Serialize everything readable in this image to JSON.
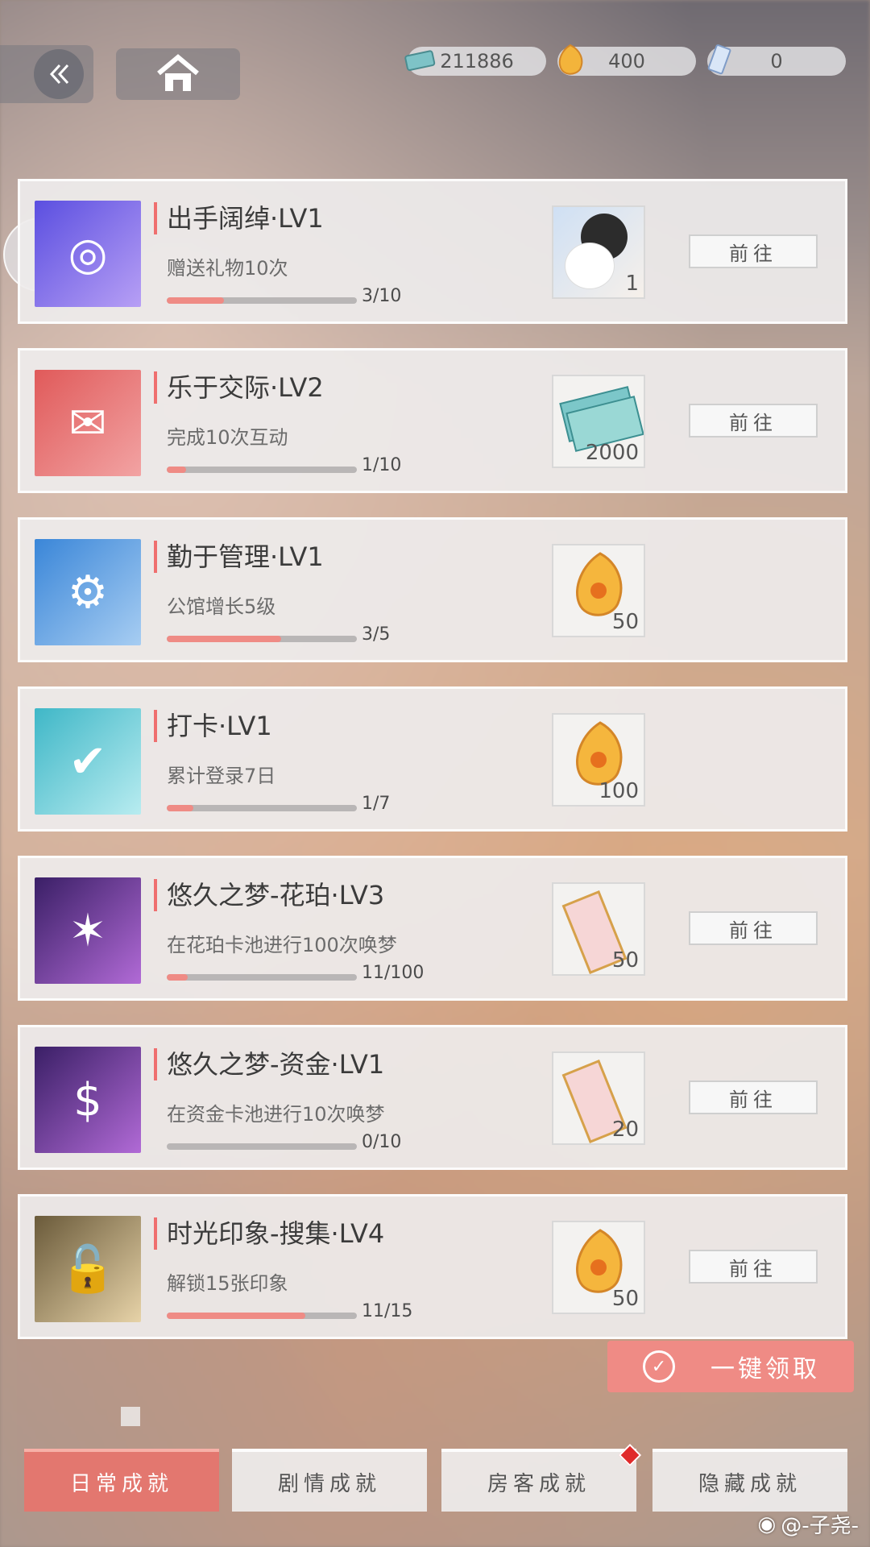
{
  "currencies": [
    {
      "icon": "cash-stack-icon",
      "value": "211886"
    },
    {
      "icon": "amber-gem-icon",
      "value": "400"
    },
    {
      "icon": "ticket-icon",
      "value": "0"
    }
  ],
  "nav": {
    "back_icon": "double-chevron-left-icon",
    "home_icon": "home-icon"
  },
  "achievements": [
    {
      "icon": "coin-gift-icon",
      "title": "出手阔绰·LV1",
      "desc": "赠送礼物10次",
      "progress": 0.3,
      "count": "3/10",
      "reward": "cat-portrait",
      "reward_qty": "1",
      "action": "前往"
    },
    {
      "icon": "chat-bubbles-icon",
      "title": "乐于交际·LV2",
      "desc": "完成10次互动",
      "progress": 0.1,
      "count": "1/10",
      "reward": "cash-stack",
      "reward_qty": "2000",
      "action": "前往"
    },
    {
      "icon": "gear-castle-icon",
      "title": "勤于管理·LV1",
      "desc": "公馆增长5级",
      "progress": 0.6,
      "count": "3/5",
      "reward": "amber-gem",
      "reward_qty": "50",
      "action": ""
    },
    {
      "icon": "calendar-check-icon",
      "title": "打卡·LV1",
      "desc": "累计登录7日",
      "progress": 0.14,
      "count": "1/7",
      "reward": "amber-gem",
      "reward_qty": "100",
      "action": ""
    },
    {
      "icon": "star-crest-icon",
      "title": "悠久之梦-花珀·LV3",
      "desc": "在花珀卡池进行100次唤梦",
      "progress": 0.11,
      "count": "11/100",
      "reward": "ticket",
      "reward_qty": "50",
      "action": "前往"
    },
    {
      "icon": "coin-crest-icon",
      "title": "悠久之梦-资金·LV1",
      "desc": "在资金卡池进行10次唤梦",
      "progress": 0.0,
      "count": "0/10",
      "reward": "ticket",
      "reward_qty": "20",
      "action": "前往"
    },
    {
      "icon": "unlock-cards-icon",
      "title": "时光印象-搜集·LV4",
      "desc": "解锁15张印象",
      "progress": 0.73,
      "count": "11/15",
      "reward": "amber-gem",
      "reward_qty": "50",
      "action": "前往"
    }
  ],
  "claim_all": "一键领取",
  "tabs": [
    {
      "label": "日常成就",
      "active": true
    },
    {
      "label": "剧情成就",
      "active": false
    },
    {
      "label": "房客成就",
      "active": false,
      "alert": true
    },
    {
      "label": "隐藏成就",
      "active": false
    }
  ],
  "watermark": "@-子尧-",
  "colors": {
    "accent": "#ef8b85",
    "tab_active": "#e3776f"
  }
}
